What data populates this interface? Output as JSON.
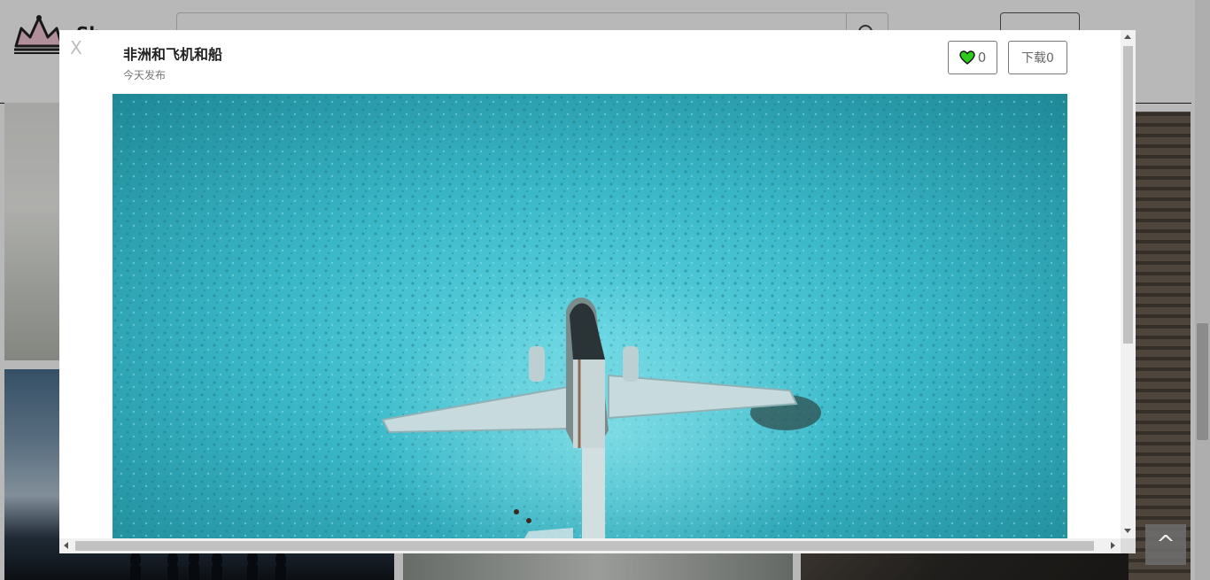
{
  "site": {
    "brand_text": "Sh",
    "login_label": ""
  },
  "modal": {
    "close_label": "X",
    "title": "非洲和飞机和船",
    "subtitle": "今天发布",
    "like_count": "0",
    "download_label": "下载0"
  },
  "back_to_top_label": "^",
  "colors": {
    "heart": "#2ecc1a",
    "water": "#3ab8c8",
    "overlay": "rgba(0,0,0,0.28)"
  },
  "icons": {
    "logo": "crown-logo",
    "search": "search-icon",
    "like": "heart-icon"
  }
}
